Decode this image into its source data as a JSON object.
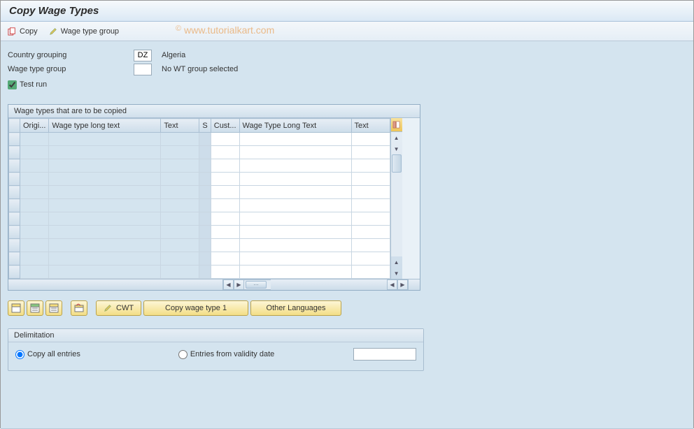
{
  "title": "Copy Wage Types",
  "watermark": "www.tutorialkart.com",
  "toolbar": {
    "copy_label": "Copy",
    "wage_type_group_label": "Wage type group"
  },
  "form": {
    "country_grouping_label": "Country grouping",
    "country_grouping_code": "DZ",
    "country_grouping_desc": "Algeria",
    "wage_type_group_label": "Wage type group",
    "wage_type_group_code": "",
    "wage_type_group_desc": "No WT group selected",
    "test_run_label": "Test run",
    "test_run_checked": true
  },
  "table": {
    "caption": "Wage types that are to be copied",
    "columns": {
      "original": "Origi...",
      "long_text_1": "Wage type long text",
      "text_1": "Text",
      "s": "S",
      "cust": "Cust...",
      "long_text_2": "Wage Type Long Text",
      "text_2": "Text"
    },
    "row_count": 11
  },
  "buttons": {
    "cwt_label": "CWT",
    "copy_wage_type_label": "Copy wage type 1",
    "other_languages_label": "Other Languages"
  },
  "delimitation": {
    "group_title": "Delimitation",
    "copy_all_label": "Copy all entries",
    "entries_from_label": "Entries from validity date",
    "date_value": "",
    "selected": "copy_all"
  }
}
